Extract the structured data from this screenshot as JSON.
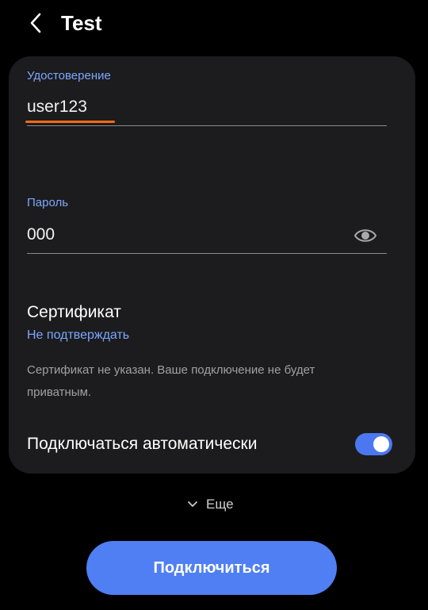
{
  "header": {
    "title": "Test",
    "back_icon": "chevron-left-icon"
  },
  "identity": {
    "label": "Удостоверение",
    "value": "user123"
  },
  "password": {
    "label": "Пароль",
    "value": "000",
    "visibility_icon": "eye-icon"
  },
  "certificate": {
    "title": "Сертификат",
    "value": "Не подтверждать",
    "note": "Сертификат не указан. Ваше подключение не будет приватным."
  },
  "auto_connect": {
    "label": "Подключаться автоматически",
    "enabled": true
  },
  "more": {
    "label": "Еще",
    "icon": "chevron-down-icon"
  },
  "connect_button": {
    "label": "Подключиться"
  },
  "colors": {
    "background": "#000000",
    "card": "#1c1c1e",
    "accent": "#4f7ff2",
    "label_blue": "#7ea6ff",
    "spellcheck_underline": "#ff6a1a"
  }
}
